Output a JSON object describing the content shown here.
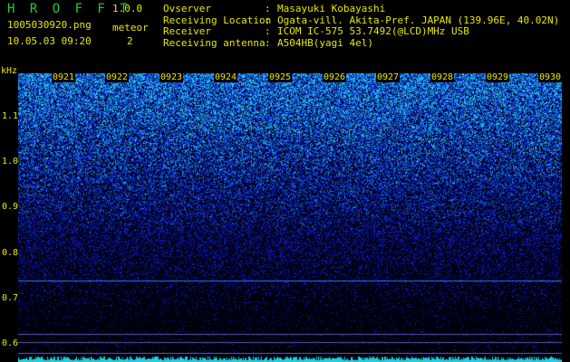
{
  "header": {
    "app_title": "H R O F F T",
    "version": "1.0.0",
    "filename": "1005030920.png",
    "datetime": "10.05.03 09:20",
    "meteor_label": "meteor",
    "meteor_count": "2"
  },
  "info": [
    {
      "key": "Ovserver",
      "sep": ":",
      "value": "Masayuki Kobayashi"
    },
    {
      "key": "Receiving Location",
      "sep": ":",
      "value": "Ogata-vill. Akita-Pref. JAPAN (139.96E, 40.02N)"
    },
    {
      "key": "Receiver",
      "sep": ":",
      "value": "ICOM IC-575 53.7492(@LCD)MHz USB"
    },
    {
      "key": "Receiving antenna",
      "sep": ":",
      "value": "A504HB(yagi 4el)"
    }
  ],
  "axis": {
    "unit": "kHz",
    "y_labels": [
      "1.1",
      "1.0",
      "0.9",
      "0.8",
      "0.7",
      "0.6"
    ],
    "time_labels": [
      "0921",
      "0922",
      "0923",
      "0924",
      "0925",
      "0926",
      "0927",
      "0928",
      "0929",
      "0930"
    ]
  },
  "colors": {
    "text": "#e8e800",
    "title": "#22d030",
    "background": "#000000"
  }
}
